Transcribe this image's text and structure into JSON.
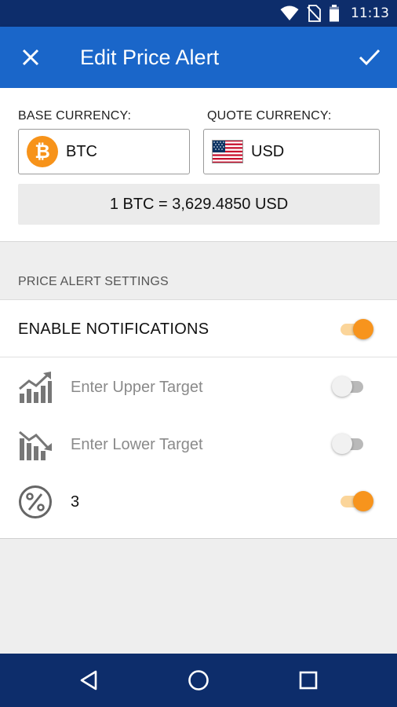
{
  "status_bar": {
    "time": "11:13",
    "icons": [
      "wifi-icon",
      "no-sim-icon",
      "battery-icon"
    ]
  },
  "app_bar": {
    "title": "Edit Price Alert",
    "close_icon": "close-icon",
    "confirm_icon": "check-icon",
    "color": "#1a66c9"
  },
  "currency": {
    "base_label": "BASE CURRENCY:",
    "base_code": "BTC",
    "base_icon": "bitcoin-icon",
    "base_symbol": "₿",
    "quote_label": "QUOTE CURRENCY:",
    "quote_code": "USD",
    "quote_icon": "us-flag-icon",
    "rate": "1 BTC = 3,629.4850 USD"
  },
  "settings": {
    "header": "PRICE ALERT SETTINGS",
    "enable_notifications": {
      "label": "ENABLE NOTIFICATIONS",
      "enabled": true
    },
    "upper_target": {
      "icon": "trend-up-icon",
      "placeholder": "Enter Upper Target",
      "enabled": false
    },
    "lower_target": {
      "icon": "trend-down-icon",
      "placeholder": "Enter Lower Target",
      "enabled": false
    },
    "percent_target": {
      "icon": "percent-icon",
      "value": "3",
      "enabled": true
    },
    "accent_color": "#f7941d"
  },
  "nav_bar": {
    "back_icon": "back-triangle-icon",
    "home_icon": "home-circle-icon",
    "recents_icon": "recents-square-icon"
  }
}
